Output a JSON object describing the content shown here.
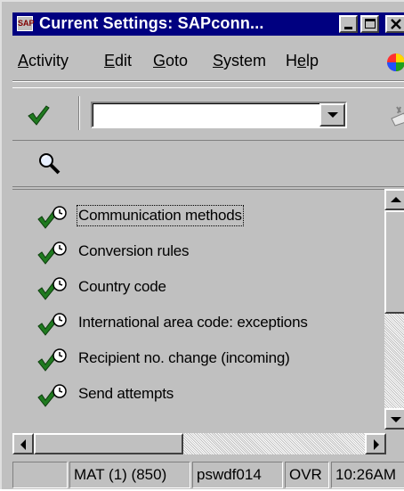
{
  "window": {
    "title": "Current Settings: SAPconn...",
    "sys_icon": "SAP"
  },
  "menu": [
    {
      "label": "Activity",
      "accel": "A",
      "rest": "ctivity"
    },
    {
      "label": "Edit",
      "accel": "E",
      "rest": "dit"
    },
    {
      "label": "Goto",
      "accel": "G",
      "rest": "oto"
    },
    {
      "label": "System",
      "accel": "S",
      "rest": "ystem"
    },
    {
      "label": "Help",
      "accel": "",
      "pre": "H",
      "u": "e",
      "rest": "lp"
    }
  ],
  "toolbar": {
    "command_field_value": "",
    "check_icon": "green-check-icon",
    "save_icon": "save-icon"
  },
  "app_toolbar": {
    "find_icon": "magnifier-icon"
  },
  "list": {
    "items": [
      {
        "label": "Communication methods",
        "icon": "execute-clock-icon",
        "selected": true
      },
      {
        "label": "Conversion rules",
        "icon": "execute-clock-icon",
        "selected": false
      },
      {
        "label": "Country code",
        "icon": "execute-clock-icon",
        "selected": false
      },
      {
        "label": "International area code: exceptions",
        "icon": "execute-clock-icon",
        "selected": false
      },
      {
        "label": "Recipient no. change (incoming)",
        "icon": "execute-clock-icon",
        "selected": false
      },
      {
        "label": "Send attempts",
        "icon": "execute-clock-icon",
        "selected": false
      }
    ]
  },
  "statusbar": {
    "system": "MAT (1) (850)",
    "server": "pswdf014",
    "mode": "OVR",
    "time": "10:26AM"
  },
  "colors": {
    "titlebar": "#000080",
    "face": "#c0c0c0",
    "check_green": "#1f7a1f"
  }
}
